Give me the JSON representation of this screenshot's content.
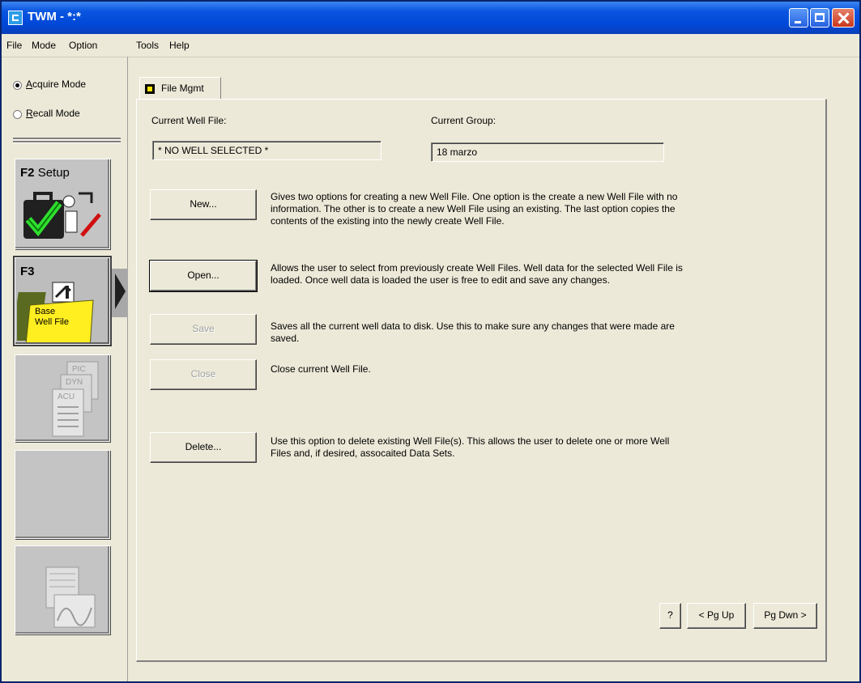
{
  "window": {
    "title": "TWM - *:*"
  },
  "menubar": [
    "File",
    "Mode",
    "Option",
    "Tools",
    "Help"
  ],
  "modes": {
    "acquire": "Acquire Mode",
    "recall": "Recall Mode",
    "selected": "acquire"
  },
  "fkeys": {
    "setup": {
      "key": "F2",
      "label": "Setup"
    },
    "base_well_file": {
      "key": "F3",
      "label_line1": "Base",
      "label_line2": "Well File"
    },
    "docs_labels": [
      "PIC",
      "DYN",
      "ACU"
    ]
  },
  "tab": {
    "label": "File Mgmt"
  },
  "current_well_file": {
    "label": "Current Well File:",
    "value": "* NO WELL SELECTED *"
  },
  "current_group": {
    "label": "Current Group:",
    "value": "18 marzo"
  },
  "actions": [
    {
      "label": "New...",
      "enabled": true,
      "description": "Gives two options for creating a new Well File.  One option is the create a new Well File with no information.  The other is to create a new Well File using an existing.  The last option copies the contents of the existing into the newly create Well File."
    },
    {
      "label": "Open...",
      "enabled": true,
      "description": "Allows the user to select from previously create Well Files.  Well data for the selected Well File is loaded.  Once well data is loaded the user is free to edit and save any changes."
    },
    {
      "label": "Save",
      "enabled": false,
      "description": "Saves all the current well data to disk.  Use this to make sure any changes that were made are saved."
    },
    {
      "label": "Close",
      "enabled": false,
      "description": "Close current Well File."
    },
    {
      "label": "Delete...",
      "enabled": true,
      "description": "Use this option to delete existing Well File(s).  This allows the user to delete one or more Well Files and, if desired, assocaited Data Sets."
    }
  ],
  "nav": {
    "help": "?",
    "pg_up": "< Pg Up",
    "pg_down": "Pg Dwn >"
  },
  "colors": {
    "titlebar": "#0a55e0",
    "face": "#ece9d8",
    "tab_marker": "#ffe400"
  }
}
